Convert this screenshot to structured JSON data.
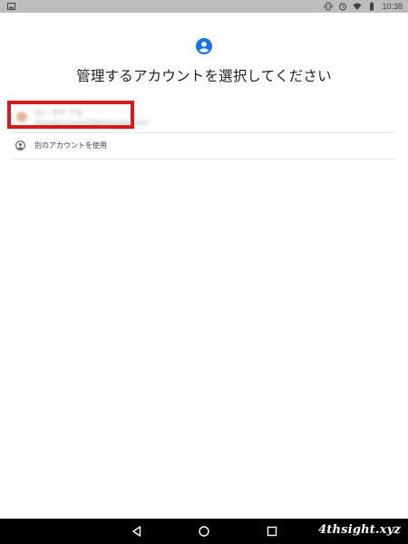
{
  "status_bar": {
    "time": "10:38",
    "icons": [
      "image-icon",
      "vibrate-icon",
      "alarm-icon",
      "wifi-icon",
      "battery-icon"
    ]
  },
  "header": {
    "icon": "account-circle-icon",
    "title": "管理するアカウントを選択してください"
  },
  "accounts": [
    {
      "name": "ロー マヤ アカ",
      "email": "blurred.account@example.com",
      "avatar_color": "#e9b79c",
      "highlighted": true,
      "obscured": true
    }
  ],
  "other_account": {
    "icon": "account-circle-icon",
    "label": "別のアカウントを使用"
  },
  "nav_bar": {
    "buttons": [
      "back-icon",
      "home-icon",
      "recents-icon"
    ]
  },
  "watermark": "4thsight.xyz",
  "colors": {
    "accent": "#1a73e8",
    "highlight": "#d7191c",
    "status_bar": "#bdbdbd",
    "nav_bar": "#000000"
  }
}
